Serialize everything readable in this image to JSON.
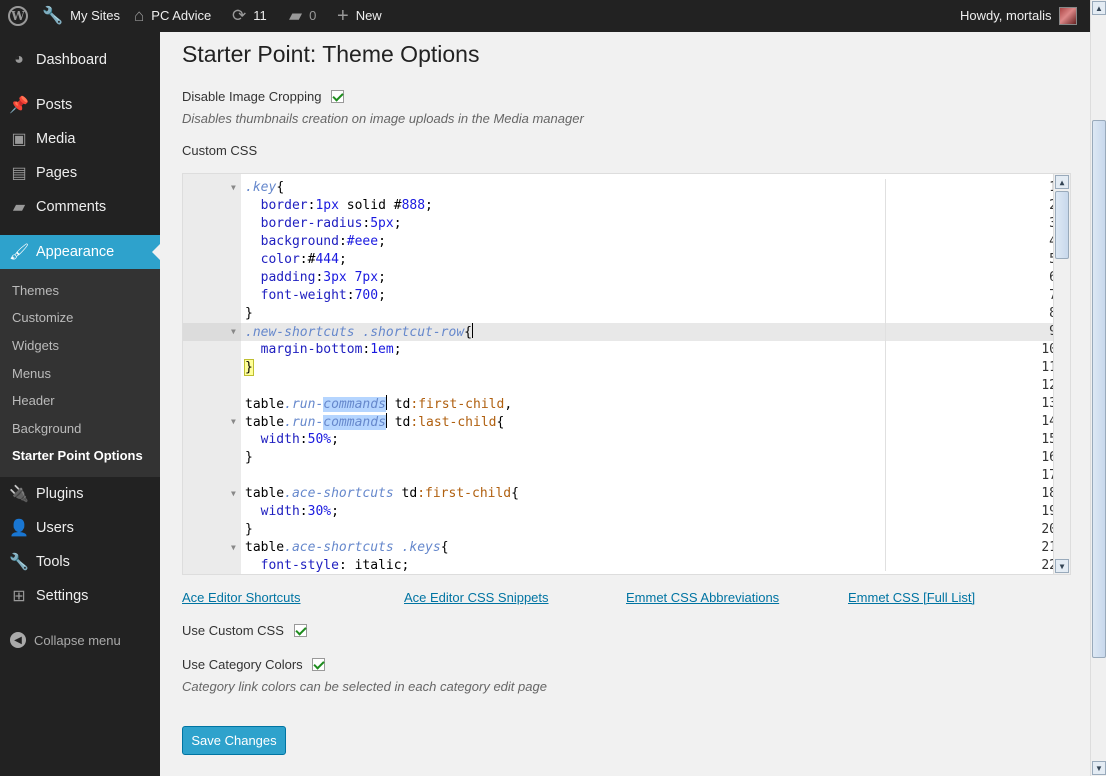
{
  "admin_bar": {
    "my_sites": "My Sites",
    "site_name": "PC Advice",
    "updates_count": "11",
    "comments_count": "0",
    "new_label": "New",
    "howdy": "Howdy, mortalis"
  },
  "sidebar": {
    "dashboard": "Dashboard",
    "posts": "Posts",
    "media": "Media",
    "pages": "Pages",
    "comments": "Comments",
    "appearance": "Appearance",
    "sub": {
      "themes": "Themes",
      "customize": "Customize",
      "widgets": "Widgets",
      "menus": "Menus",
      "header": "Header",
      "background": "Background",
      "starter": "Starter Point Options"
    },
    "plugins": "Plugins",
    "users": "Users",
    "tools": "Tools",
    "settings": "Settings",
    "collapse": "Collapse menu"
  },
  "page": {
    "title": "Starter Point: Theme Options",
    "disable_crop_label": "Disable Image Cropping",
    "disable_crop_checked": true,
    "disable_crop_desc": "Disables thumbnails creation on image uploads in the Media manager",
    "custom_css_label": "Custom CSS",
    "links": {
      "ace_shortcuts": "Ace Editor Shortcuts",
      "ace_snippets": "Ace Editor CSS Snippets",
      "emmet_abbr": "Emmet CSS Abbreviations",
      "emmet_full": "Emmet CSS [Full List]"
    },
    "use_custom_css_label": "Use Custom CSS",
    "use_custom_css_checked": true,
    "use_category_colors_label": "Use Category Colors",
    "use_category_colors_checked": true,
    "category_desc": "Category link colors can be selected in each category edit page",
    "save_button": "Save Changes"
  },
  "editor": {
    "active_line": 9,
    "lines": [
      ".key{",
      "  border:1px solid #888;",
      "  border-radius:5px;",
      "  background:#eee;",
      "  color:#444;",
      "  padding:3px 7px;",
      "  font-weight:700;",
      "}",
      ".new-shortcuts .shortcut-row{",
      "  margin-bottom:1em;",
      "}",
      "",
      "table.run-commands td:first-child,",
      "table.run-commands td:last-child{",
      "  width:50%;",
      "}",
      "",
      "table.ace-shortcuts td:first-child{",
      "  width:30%;",
      "}",
      "table.ace-shortcuts .keys{",
      "  font-style: italic;"
    ],
    "line_numbers": [
      "1",
      "2",
      "3",
      "4",
      "5",
      "6",
      "7",
      "8",
      "9",
      "10",
      "11",
      "12",
      "13",
      "14",
      "15",
      "16",
      "17",
      "18",
      "19",
      "20",
      "21",
      "22"
    ],
    "fold_lines": [
      "1",
      "9",
      "14",
      "18",
      "21"
    ]
  }
}
